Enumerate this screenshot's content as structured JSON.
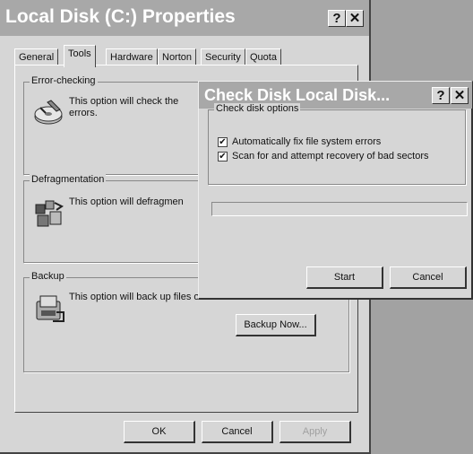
{
  "window": {
    "title": "Local Disk (C:) Properties",
    "help_button": "?",
    "close_button": "✕"
  },
  "tabs": [
    {
      "label": "General"
    },
    {
      "label": "Tools"
    },
    {
      "label": "Hardware"
    },
    {
      "label": "Norton"
    },
    {
      "label": "Security"
    },
    {
      "label": "Quota"
    }
  ],
  "active_tab": "Tools",
  "error_checking": {
    "label": "Error-checking",
    "text_line1": "This option will check the",
    "text_line2": "errors."
  },
  "defrag": {
    "label": "Defragmentation",
    "text": "This option will defragmen"
  },
  "backup": {
    "label": "Backup",
    "text": "This option will back up files on the volume.",
    "button": "Backup Now..."
  },
  "footer": {
    "ok": "OK",
    "cancel": "Cancel",
    "apply": "Apply"
  },
  "check_disk": {
    "title": "Check Disk Local Disk...",
    "help_button": "?",
    "close_button": "✕",
    "options_label": "Check disk options",
    "option1": {
      "label": "Automatically fix file system errors",
      "checked": true
    },
    "option2": {
      "label": "Scan for and attempt recovery of bad sectors",
      "checked": true
    },
    "start": "Start",
    "cancel": "Cancel"
  },
  "colors": {
    "titlebar": "#a8a8a8",
    "face": "#d6d6d6",
    "desktop": "#a2a2a2"
  },
  "icons": [
    "disk-check-icon",
    "defragment-icon",
    "backup-icon",
    "checkmark-icon"
  ]
}
